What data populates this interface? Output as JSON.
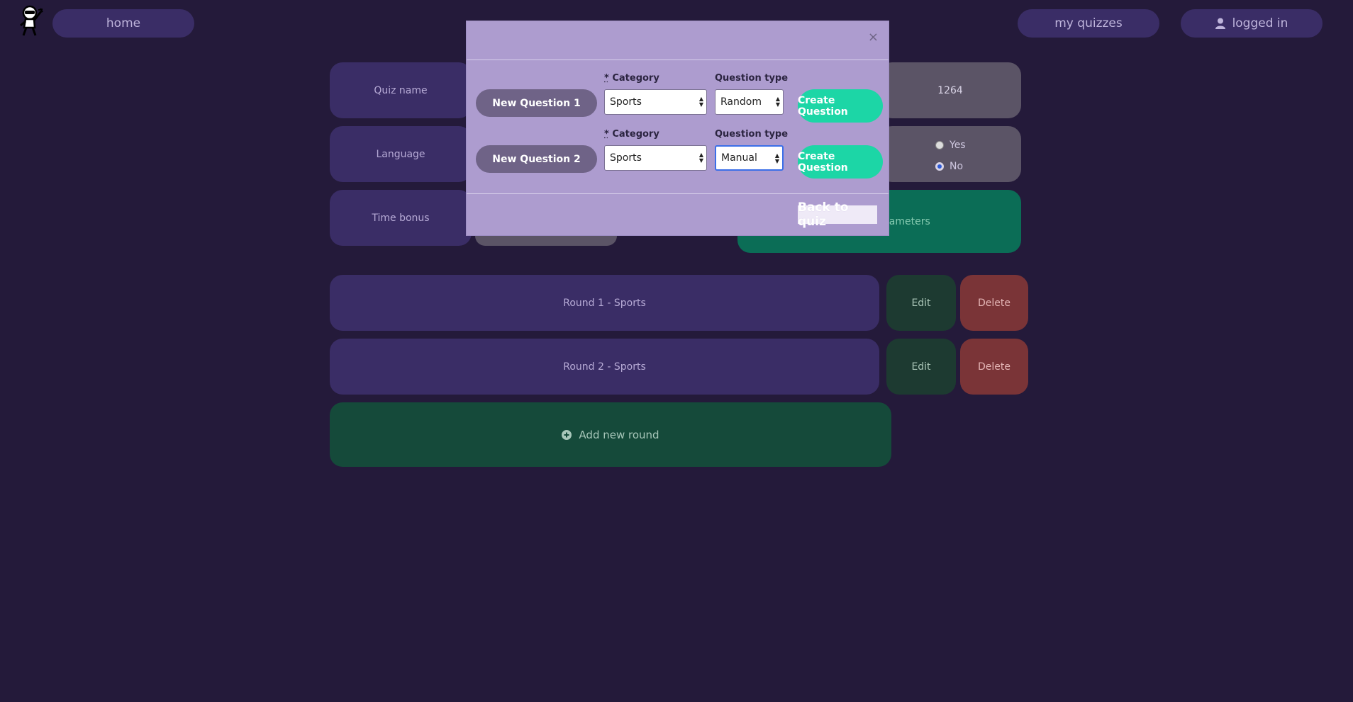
{
  "nav": {
    "home": "home",
    "my_quizzes": "my quizzes",
    "logged_in": "logged in"
  },
  "form": {
    "quiz_name_label": "Quiz name",
    "quiz_code_value": "1264",
    "language_label": "Language",
    "radio_yes": "Yes",
    "radio_no": "No",
    "time_bonus_label": "Time bonus",
    "parameters_partial": "rameters"
  },
  "rounds": [
    {
      "label": "Round 1 - Sports",
      "edit": "Edit",
      "delete": "Delete"
    },
    {
      "label": "Round 2 - Sports",
      "edit": "Edit",
      "delete": "Delete"
    }
  ],
  "add_round": "Add new round",
  "modal": {
    "close": "×",
    "questions": [
      {
        "name": "New Question 1",
        "category_label": "Category",
        "category": "Sports",
        "type_label": "Question type",
        "type": "Random",
        "create": "Create Question"
      },
      {
        "name": "New Question 2",
        "category_label": "Category",
        "category": "Sports",
        "type_label": "Question type",
        "type": "Manual",
        "create": "Create Question"
      }
    ],
    "required_mark": "*",
    "back": "Back to quiz"
  },
  "colors": {
    "background": "#241a3a",
    "accent_green": "#1cd6a6",
    "modal_bg": "#ad9ccf"
  }
}
